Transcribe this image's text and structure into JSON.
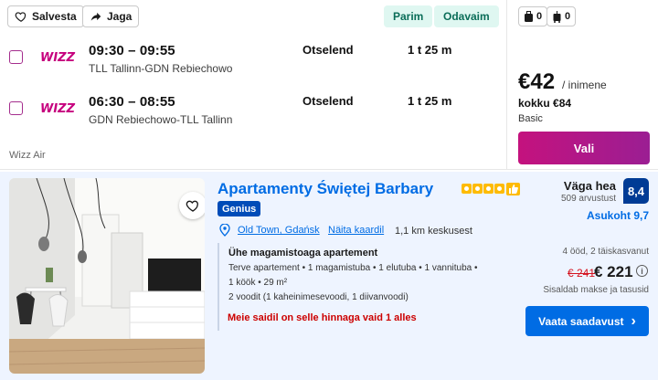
{
  "flight": {
    "save_label": "Salvesta",
    "share_label": "Jaga",
    "tags": [
      "Parim",
      "Odavaim"
    ],
    "legs": [
      {
        "time": "09:30 – 09:55",
        "route": "TLL Tallinn-GDN Rebiechowo",
        "type": "Otselend",
        "duration": "1 t 25 m"
      },
      {
        "time": "06:30 – 08:55",
        "route": "GDN Rebiechowo-TLL Tallinn",
        "type": "Otselend",
        "duration": "1 t 25 m"
      }
    ],
    "airline": "Wizz Air",
    "logo_text": "WIZZ",
    "bags": [
      {
        "icon": "suitcase-icon",
        "count": "0"
      },
      {
        "icon": "trolley-bag-icon",
        "count": "0"
      }
    ],
    "price": "€42",
    "price_per": "/ inimene",
    "total": "kokku €84",
    "fare": "Basic",
    "select_label": "Vali",
    "brand_color": "#c4127e"
  },
  "hotel": {
    "name": "Apartamenty Świętej Barbary",
    "stars": 4,
    "genius_label": "Genius",
    "location": "Old Town, Gdańsk",
    "map_link": "Näita kaardil",
    "distance": "1,1 km keskusest",
    "review_word": "Väga hea",
    "review_count": "509 arvustust",
    "score": "8,4",
    "location_score": "Asukoht 9,7",
    "room_title": "Ühe magamistoaga apartement",
    "room_line1": "Terve apartement • 1 magamistuba • 1 elutuba • 1 vannituba •",
    "room_line2": "1 köök • 29 m²",
    "room_beds": "2 voodit (1 kaheinimesevoodi, 1 diivanvoodi)",
    "warning": "Meie saidil on selle hinnaga vaid 1 alles",
    "nights": "4 ööd, 2 täiskasvanut",
    "old_price": "€ 241",
    "new_price": "€ 221",
    "tax_note": "Sisaldab makse ja tasusid",
    "cta_label": "Vaata saadavust",
    "cta_arrow": "›",
    "info_glyph": "i",
    "accent_color": "#006ce4"
  }
}
